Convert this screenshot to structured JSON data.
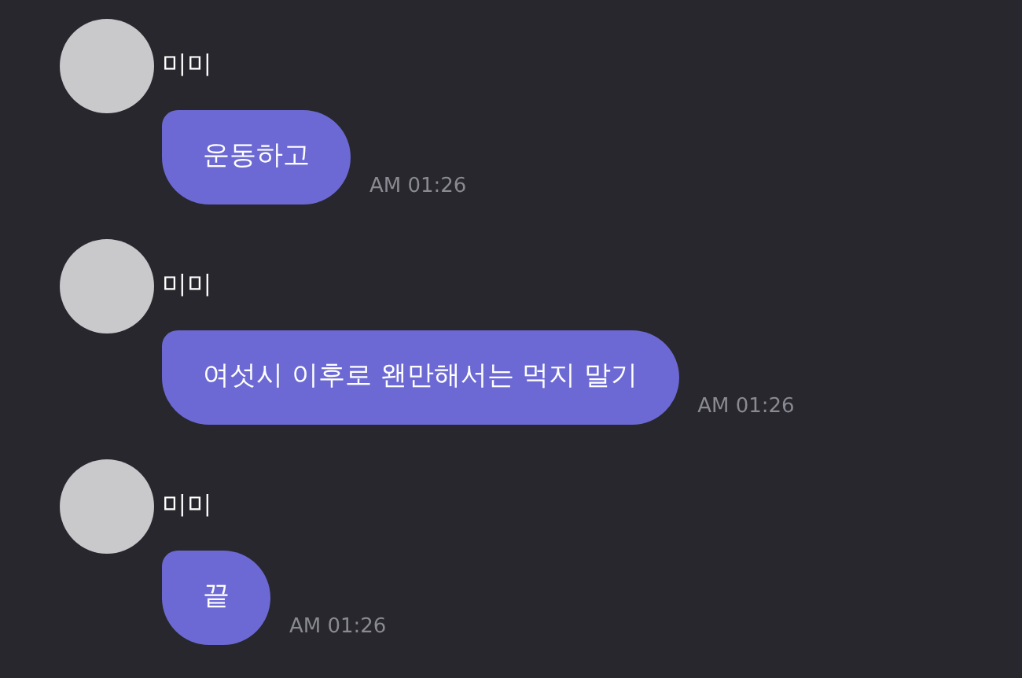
{
  "messages": [
    {
      "sender": "미미",
      "text": "운동하고",
      "time": "AM 01:26"
    },
    {
      "sender": "미미",
      "text": "여섯시 이후로 왠만해서는 먹지 말기",
      "time": "AM 01:26"
    },
    {
      "sender": "미미",
      "text": "끝",
      "time": "AM 01:26"
    }
  ]
}
